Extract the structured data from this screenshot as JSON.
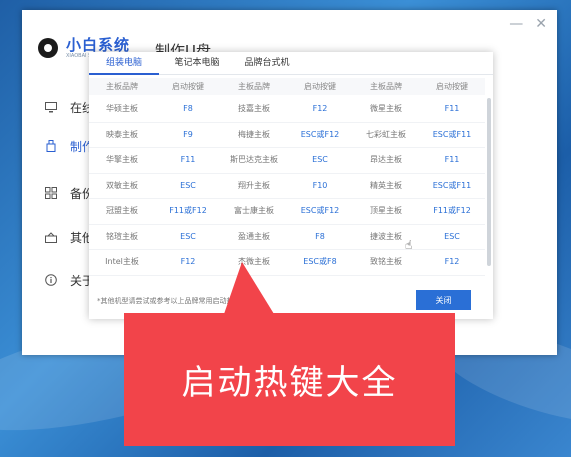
{
  "app": {
    "brand": "小白系统",
    "brand_sub": "XIAOBAI SYSTEM",
    "page_title": "制作U盘",
    "window_buttons": [
      "minimize-icon",
      "close-icon"
    ],
    "sidebar": [
      {
        "icon": "monitor-icon",
        "label": "在线"
      },
      {
        "icon": "usb-icon",
        "label": "制作"
      },
      {
        "icon": "grid-icon",
        "label": "备份"
      },
      {
        "icon": "lock-icon",
        "label": "其他"
      },
      {
        "icon": "info-icon",
        "label": "关于"
      }
    ]
  },
  "dialog": {
    "tabs": [
      {
        "label": "组装电脑",
        "active": true
      },
      {
        "label": "笔记本电脑",
        "active": false
      },
      {
        "label": "品牌台式机",
        "active": false
      }
    ],
    "headers": [
      "主板品牌",
      "启动按键",
      "主板品牌",
      "启动按键",
      "主板品牌",
      "启动按键"
    ],
    "rows": [
      [
        "华硕主板",
        "F8",
        "技嘉主板",
        "F12",
        "微星主板",
        "F11"
      ],
      [
        "映泰主板",
        "F9",
        "梅捷主板",
        "ESC或F12",
        "七彩虹主板",
        "ESC或F11"
      ],
      [
        "华擎主板",
        "F11",
        "斯巴达克主板",
        "ESC",
        "昂达主板",
        "F11"
      ],
      [
        "双敏主板",
        "ESC",
        "翔升主板",
        "F10",
        "精英主板",
        "ESC或F11"
      ],
      [
        "冠盟主板",
        "F11或F12",
        "富士康主板",
        "ESC或F12",
        "顶星主板",
        "F11或F12"
      ],
      [
        "铭瑄主板",
        "ESC",
        "盈通主板",
        "F8",
        "捷波主板",
        "ESC"
      ],
      [
        "Intel主板",
        "F12",
        "杰微主板",
        "ESC或F8",
        "致铭主板",
        "F12"
      ]
    ],
    "footer_note": "*其他机型请尝试或参考以上品牌常用启动热键",
    "close_label": "关闭"
  },
  "callout": {
    "text": "启动热键大全",
    "color": "#f2444a"
  }
}
